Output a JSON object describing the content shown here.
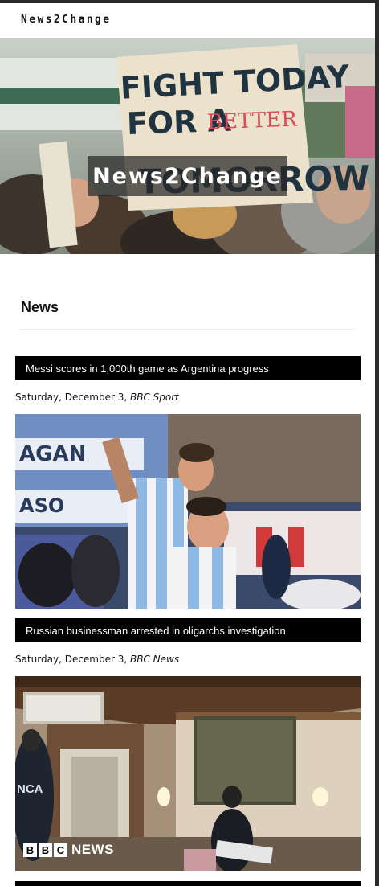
{
  "header": {
    "site_name": "News2Change"
  },
  "hero": {
    "title": "News2Change",
    "sign_lines": [
      "FIGHT TODAY",
      "FOR A",
      "BETTER",
      "TOMORROW"
    ]
  },
  "section": {
    "title": "News"
  },
  "articles": [
    {
      "headline": "Messi scores in 1,000th game as Argentina progress",
      "date": "Saturday, December 3, ",
      "source": "BBC Sport"
    },
    {
      "headline": "Russian businessman arrested in oligarchs investigation",
      "date": "Saturday, December 3, ",
      "source": "BBC News",
      "image_badge": {
        "letters": [
          "B",
          "B",
          "C"
        ],
        "text": "NEWS",
        "vest_text": "NCA"
      }
    }
  ]
}
